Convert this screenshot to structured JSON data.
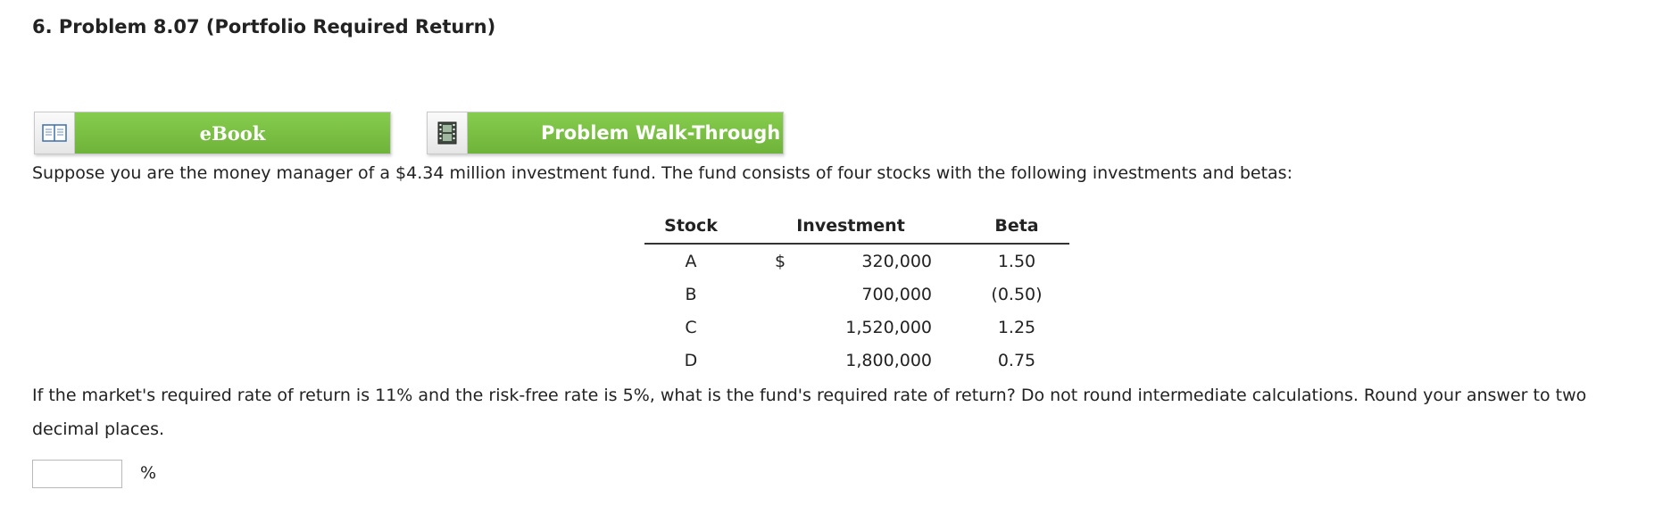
{
  "problem": {
    "title": "6. Problem 8.07 (Portfolio Required Return)"
  },
  "buttons": {
    "ebook": {
      "label": "eBook",
      "icon": "book-icon"
    },
    "walkthrough": {
      "label": "Problem Walk-Through",
      "icon": "film-icon"
    }
  },
  "intro_text": "Suppose you are the money manager of a $4.34 million investment fund. The fund consists of four stocks with the following investments and betas:",
  "table": {
    "headers": [
      "Stock",
      "Investment",
      "Beta"
    ],
    "currency_symbol": "$",
    "rows": [
      {
        "stock": "A",
        "investment": "320,000",
        "beta": "1.50"
      },
      {
        "stock": "B",
        "investment": "700,000",
        "beta": "(0.50)"
      },
      {
        "stock": "C",
        "investment": "1,520,000",
        "beta": "1.25"
      },
      {
        "stock": "D",
        "investment": "1,800,000",
        "beta": "0.75"
      }
    ]
  },
  "question_text": "If the market's required rate of return is 11% and the risk-free rate is 5%, what is the fund's required rate of return? Do not round intermediate calculations. Round your answer to two decimal places.",
  "answer": {
    "value": "",
    "unit": "%"
  },
  "colors": {
    "button_green": "#7ac043",
    "text": "#222222"
  }
}
